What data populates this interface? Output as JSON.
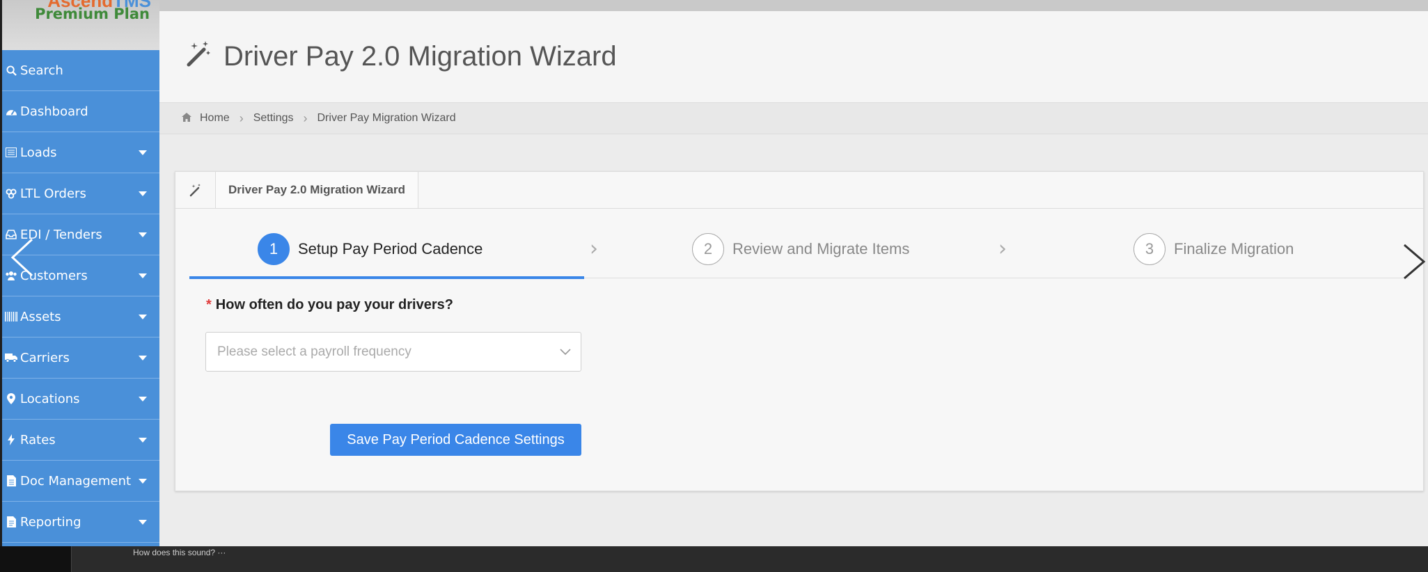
{
  "logo": {
    "brand_left": "Ascend",
    "brand_right": "TMS",
    "plan": "Premium Plan"
  },
  "sidebar": {
    "items": [
      {
        "label": "Search",
        "icon": "search-icon",
        "has_caret": false
      },
      {
        "label": "Dashboard",
        "icon": "dashboard-icon",
        "has_caret": false
      },
      {
        "label": "Loads",
        "icon": "list-icon",
        "has_caret": true
      },
      {
        "label": "LTL Orders",
        "icon": "boxes-icon",
        "has_caret": true
      },
      {
        "label": "EDI / Tenders",
        "icon": "inbox-icon",
        "has_caret": true
      },
      {
        "label": "Customers",
        "icon": "users-icon",
        "has_caret": true
      },
      {
        "label": "Assets",
        "icon": "barcode-icon",
        "has_caret": true
      },
      {
        "label": "Carriers",
        "icon": "truck-icon",
        "has_caret": true
      },
      {
        "label": "Locations",
        "icon": "map-pin-icon",
        "has_caret": true
      },
      {
        "label": "Rates",
        "icon": "bolt-icon",
        "has_caret": true
      },
      {
        "label": "Doc Management",
        "icon": "document-icon",
        "has_caret": true
      },
      {
        "label": "Reporting",
        "icon": "report-icon",
        "has_caret": true
      }
    ]
  },
  "header": {
    "title": "Driver Pay 2.0 Migration Wizard",
    "icon": "magic-wand-icon"
  },
  "breadcrumb": {
    "home": "Home",
    "settings": "Settings",
    "current": "Driver Pay Migration Wizard"
  },
  "card": {
    "tab_label": "Driver Pay 2.0 Migration Wizard",
    "steps": [
      {
        "number": "1",
        "label": "Setup Pay Period Cadence",
        "active": true
      },
      {
        "number": "2",
        "label": "Review and Migrate Items",
        "active": false
      },
      {
        "number": "3",
        "label": "Finalize Migration",
        "active": false
      }
    ],
    "form": {
      "required_mark": "*",
      "question": "How often do you pay your drivers?",
      "select_placeholder": "Please select a payroll frequency",
      "save_label": "Save Pay Period Cadence Settings"
    }
  },
  "bottom": {
    "caption": "How does this sound? ···"
  },
  "colors": {
    "sidebar": "#4a90d9",
    "accent": "#3a86e8",
    "required": "#e03b3b",
    "plan": "#3f8a3a"
  }
}
